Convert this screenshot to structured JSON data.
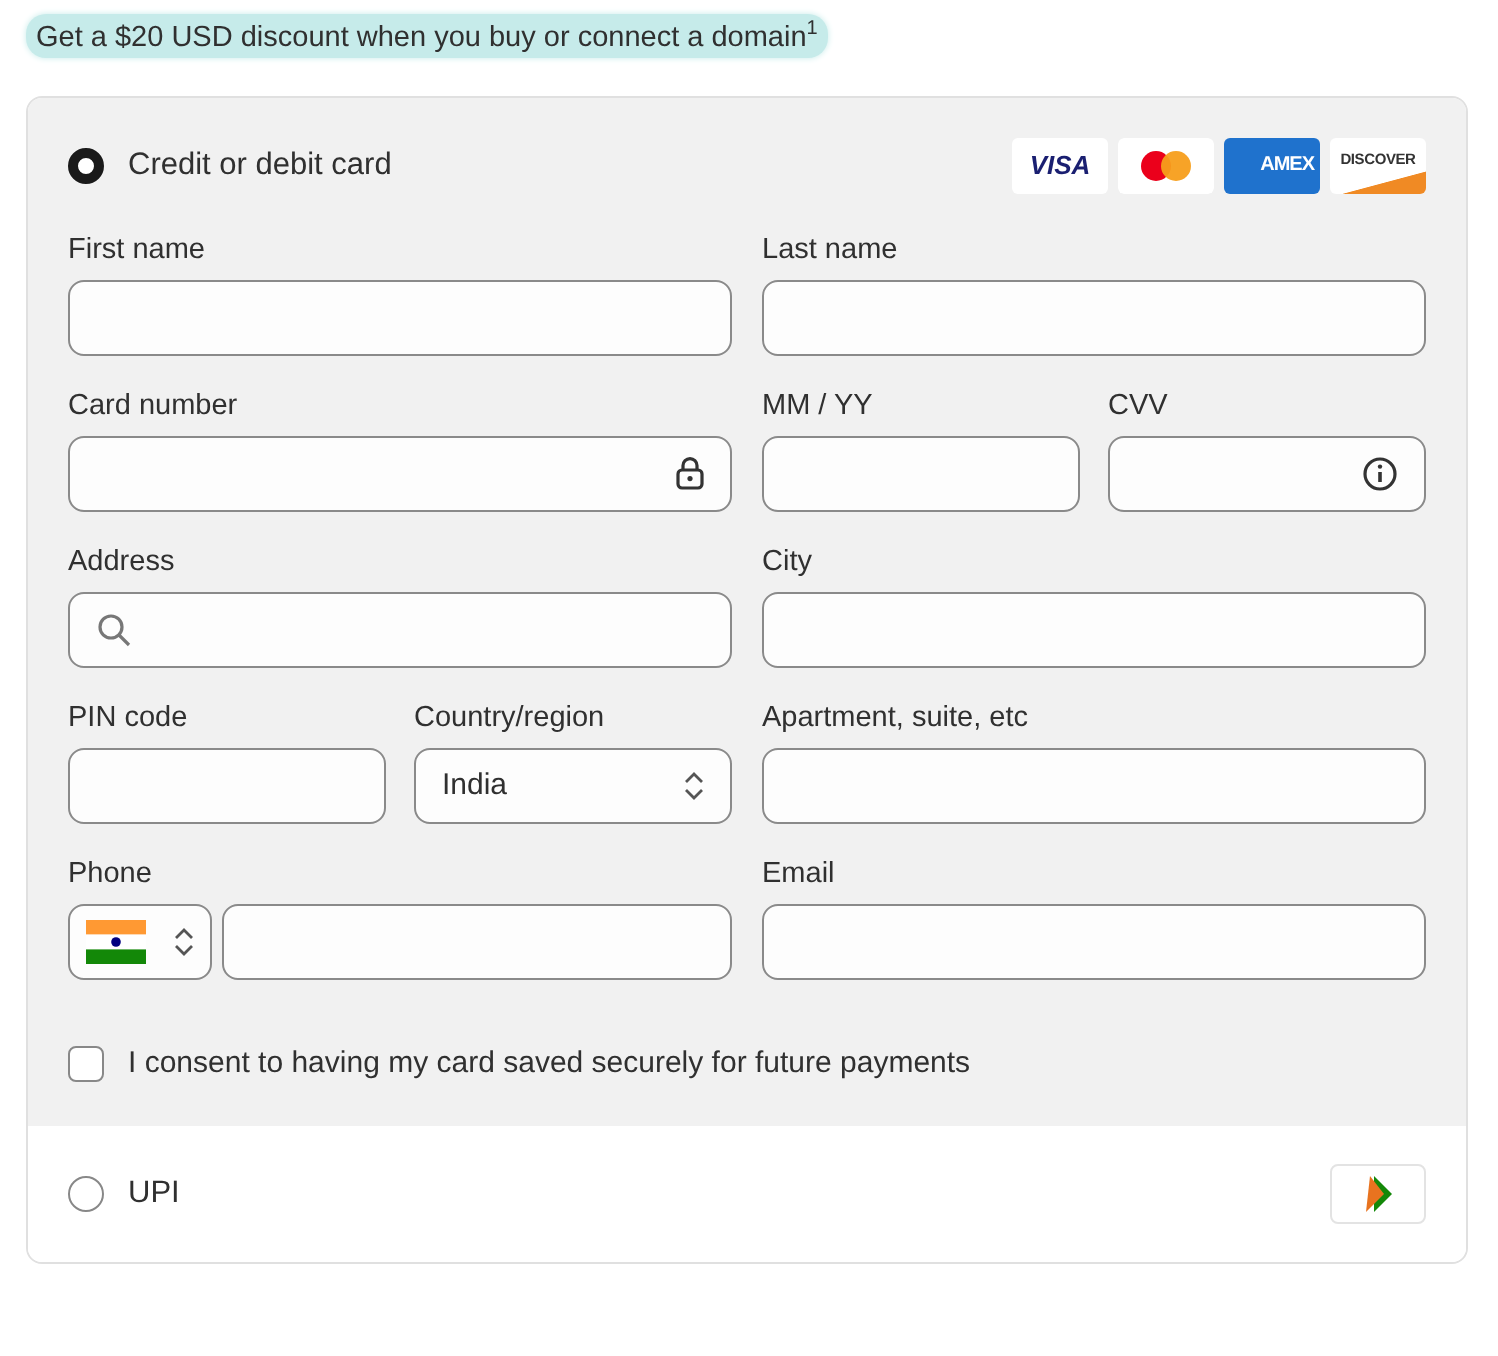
{
  "promo": {
    "text": "Get a $20 USD discount when you buy or connect a domain$^{1}$"
  },
  "methods": [
    {
      "kind": "card",
      "label": "Credit or debit card",
      "selected": true,
      "logos": [
        {
          "kind": "visa",
          "text": "VISA"
        },
        {
          "kind": "mastercard"
        },
        {
          "kind": "amex",
          "text": "AMEX"
        },
        {
          "kind": "discover",
          "text": "DISCOVER"
        }
      ]
    },
    {
      "kind": "upi",
      "label": "UPI",
      "selected": false
    }
  ],
  "form": {
    "rows": [
      {
        "left": [
          {
            "kind": "text",
            "label": "First name"
          }
        ],
        "right": [
          {
            "kind": "text",
            "label": "Last name"
          }
        ]
      },
      {
        "left": [
          {
            "kind": "secure",
            "label": "Card number"
          }
        ],
        "right": [
          {
            "kind": "text",
            "label": "MM / YY"
          },
          {
            "kind": "help",
            "label": "CVV"
          }
        ]
      },
      {
        "left": [
          {
            "kind": "address",
            "label": "Address"
          }
        ],
        "right": [
          {
            "kind": "text",
            "label": "City"
          }
        ]
      },
      {
        "left": [
          {
            "kind": "text",
            "label": "PIN code"
          },
          {
            "kind": "select",
            "label": "Country/region",
            "value": "India"
          }
        ],
        "right": [
          {
            "kind": "text",
            "label": "Apartment, suite, etc"
          }
        ]
      },
      {
        "left": [
          {
            "kind": "phone",
            "label": "Phone"
          }
        ],
        "right": [
          {
            "kind": "text",
            "label": "Email"
          }
        ]
      }
    ],
    "consent": {
      "label": "I consent to having my card saved securely for future payments",
      "checked": false
    }
  }
}
